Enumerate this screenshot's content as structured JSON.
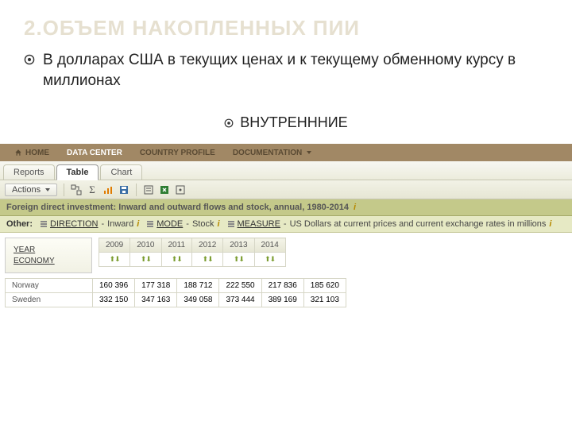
{
  "slide": {
    "title": "2.ОБЪЕМ НАКОПЛЕННЫХ ПИИ",
    "bullet": "В долларах США в текущих ценах и к текущему обменному курсу в миллионах",
    "subbullet": "ВНУТРЕНННИЕ"
  },
  "nav": {
    "home": "HOME",
    "data_center": "DATA CENTER",
    "country_profile": "COUNTRY PROFILE",
    "documentation": "DOCUMENTATION"
  },
  "tabs": {
    "reports": "Reports",
    "table": "Table",
    "chart": "Chart"
  },
  "toolbar": {
    "actions": "Actions"
  },
  "dataset": {
    "title": "Foreign direct investment: Inward and outward flows and stock, annual, 1980-2014"
  },
  "filters": {
    "other_label": "Other:",
    "direction": {
      "name": "DIRECTION",
      "value": "Inward"
    },
    "mode": {
      "name": "MODE",
      "value": "Stock"
    },
    "measure": {
      "name": "MEASURE",
      "value": "US Dollars at current prices and current exchange rates in millions"
    }
  },
  "dims": {
    "year": "YEAR",
    "economy": "ECONOMY"
  },
  "chart_data": {
    "type": "table",
    "categories": [
      "2009",
      "2010",
      "2011",
      "2012",
      "2013",
      "2014"
    ],
    "series": [
      {
        "name": "Norway",
        "values": [
          "160 396",
          "177 318",
          "188 712",
          "222 550",
          "217 836",
          "185 620"
        ]
      },
      {
        "name": "Sweden",
        "values": [
          "332 150",
          "347 163",
          "349 058",
          "373 444",
          "389 169",
          "321 103"
        ]
      }
    ]
  }
}
